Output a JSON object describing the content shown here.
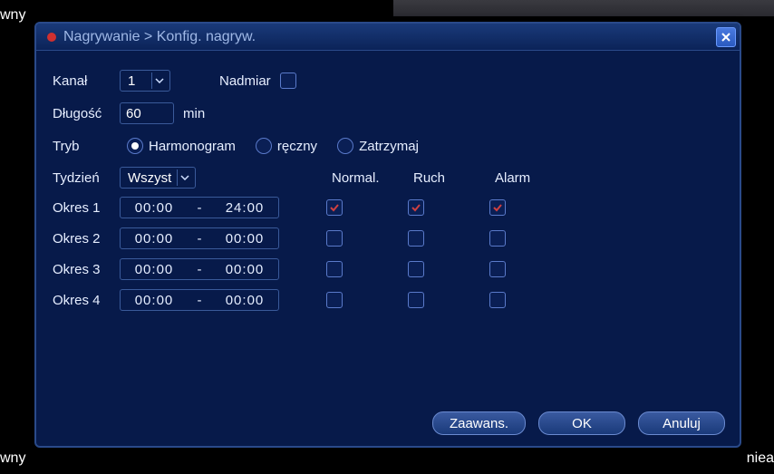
{
  "title": "Nagrywanie > Konfig. nagryw.",
  "background": {
    "topLeft": "wny",
    "bottomLeft": "wny",
    "bottomRight": "niea"
  },
  "labels": {
    "channel": "Kanał",
    "redundancy": "Nadmiar",
    "length": "Długość",
    "lengthUnit": "min",
    "mode": "Tryb",
    "week": "Tydzień"
  },
  "values": {
    "channel": "1",
    "length": "60",
    "week": "Wszyst",
    "redundancyChecked": false,
    "modeSelected": "Harmonogram"
  },
  "modes": [
    "Harmonogram",
    "ręczny",
    "Zatrzymaj"
  ],
  "columns": {
    "normal": "Normal.",
    "motion": "Ruch",
    "alarm": "Alarm"
  },
  "periods": [
    {
      "label": "Okres 1",
      "start": "00:00",
      "end": "24:00",
      "normal": true,
      "motion": true,
      "alarm": true
    },
    {
      "label": "Okres 2",
      "start": "00:00",
      "end": "00:00",
      "normal": false,
      "motion": false,
      "alarm": false
    },
    {
      "label": "Okres 3",
      "start": "00:00",
      "end": "00:00",
      "normal": false,
      "motion": false,
      "alarm": false
    },
    {
      "label": "Okres 4",
      "start": "00:00",
      "end": "00:00",
      "normal": false,
      "motion": false,
      "alarm": false
    }
  ],
  "buttons": {
    "advanced": "Zaawans.",
    "ok": "OK",
    "cancel": "Anuluj"
  }
}
